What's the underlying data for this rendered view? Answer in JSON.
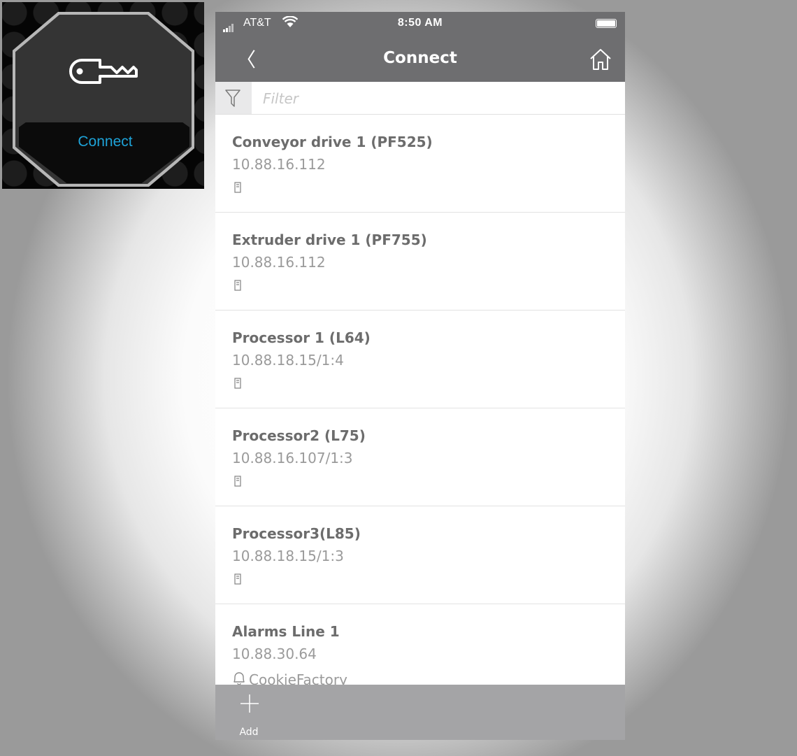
{
  "tile": {
    "icon": "key-icon",
    "label": "Connect",
    "label_color": "#1ea3d8"
  },
  "status_bar": {
    "carrier": "AT&T",
    "time": "8:50 AM"
  },
  "nav": {
    "title": "Connect",
    "back_icon": "chevron-left-icon",
    "home_icon": "home-icon"
  },
  "filter": {
    "icon": "filter-icon",
    "placeholder": "Filter",
    "value": ""
  },
  "devices": [
    {
      "name": "Conveyor drive 1 (PF525)",
      "address": "10.88.16.112",
      "icon": "device-icon"
    },
    {
      "name": "Extruder drive 1 (PF755)",
      "address": "10.88.16.112",
      "icon": "device-icon"
    },
    {
      "name": "Processor 1 (L64)",
      "address": "10.88.18.15/1:4",
      "icon": "device-icon"
    },
    {
      "name": "Processor2 (L75)",
      "address": "10.88.16.107/1:3",
      "icon": "device-icon"
    },
    {
      "name": "Processor3(L85)",
      "address": "10.88.18.15/1:3",
      "icon": "device-icon"
    },
    {
      "name": "Alarms Line 1",
      "address": "10.88.30.64",
      "icon": "bell-icon",
      "tag": "CookieFactory"
    }
  ],
  "bottom_bar": {
    "add_label": "Add",
    "add_icon": "plus-icon"
  },
  "colors": {
    "bar": "#6e6e70",
    "bottom_bar": "#a4a4a6",
    "accent": "#1ea3d8"
  }
}
